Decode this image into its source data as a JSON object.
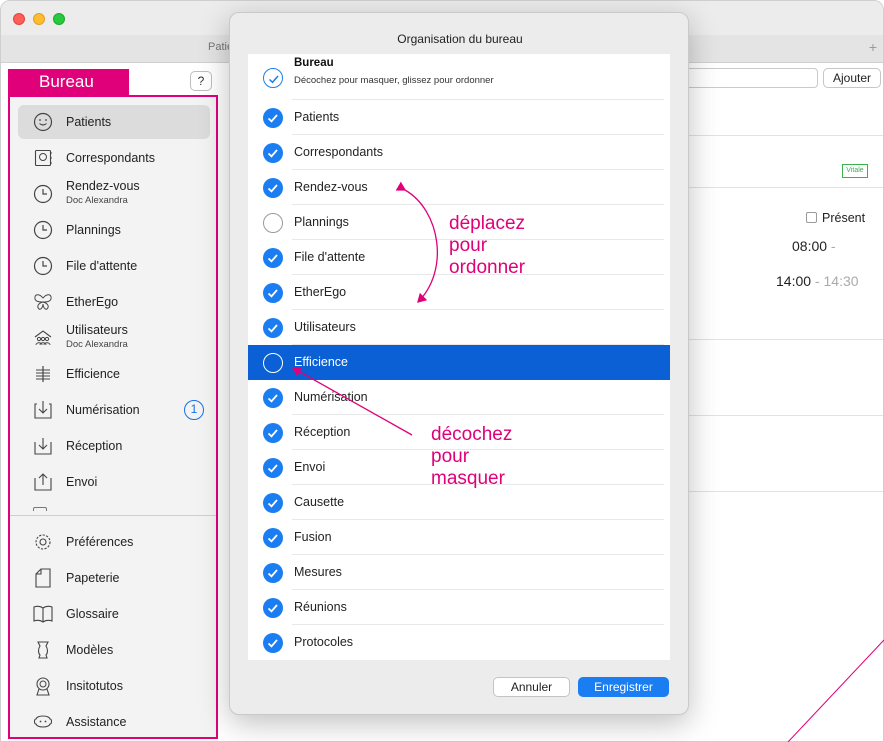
{
  "window": {
    "tab_title": "Patie",
    "tab_plus": "+"
  },
  "sidebar": {
    "title": "Bureau",
    "help": "?",
    "items": [
      {
        "label": "Patients",
        "icon": "smiley-icon",
        "selected": true
      },
      {
        "label": "Correspondants",
        "icon": "contact-card-icon"
      },
      {
        "label": "Rendez-vous",
        "sub": "Doc Alexandra",
        "icon": "clock-icon"
      },
      {
        "label": "Plannings",
        "icon": "clock-icon"
      },
      {
        "label": "File d'attente",
        "icon": "clock-icon"
      },
      {
        "label": "EtherEgo",
        "icon": "butterfly-icon"
      },
      {
        "label": "Utilisateurs",
        "sub": "Doc Alexandra",
        "icon": "users-icon"
      },
      {
        "label": "Efficience",
        "icon": "efficience-icon"
      },
      {
        "label": "Numérisation",
        "icon": "scan-icon",
        "badge": "1"
      },
      {
        "label": "Réception",
        "icon": "inbox-icon"
      },
      {
        "label": "Envoi",
        "icon": "outbox-icon"
      }
    ],
    "bottom_items": [
      {
        "label": "Préférences",
        "icon": "gear-icon"
      },
      {
        "label": "Papeterie",
        "icon": "paper-icon"
      },
      {
        "label": "Glossaire",
        "icon": "book-icon"
      },
      {
        "label": "Modèles",
        "icon": "template-icon"
      },
      {
        "label": "Insitotutos",
        "icon": "award-icon"
      },
      {
        "label": "Assistance",
        "icon": "assistance-icon"
      }
    ]
  },
  "main": {
    "add_button": "Ajouter",
    "vitale": "Vitale",
    "present_label": "Présent",
    "time1_start": "08:00",
    "time1_sep": " -",
    "time2_start": "14:00",
    "time2_sep": " - ",
    "time2_end": "14:30"
  },
  "modal": {
    "title": "Organisation du bureau",
    "header_row": {
      "title": "Bureau",
      "description": "Décochez pour masquer, glissez pour ordonner"
    },
    "rows": [
      {
        "label": "Patients",
        "checked": true
      },
      {
        "label": "Correspondants",
        "checked": true
      },
      {
        "label": "Rendez-vous",
        "checked": true
      },
      {
        "label": "Plannings",
        "checked": false
      },
      {
        "label": "File d'attente",
        "checked": true
      },
      {
        "label": "EtherEgo",
        "checked": true
      },
      {
        "label": "Utilisateurs",
        "checked": true
      },
      {
        "label": "Efficience",
        "checked": false,
        "selected": true
      },
      {
        "label": "Numérisation",
        "checked": true
      },
      {
        "label": "Réception",
        "checked": true
      },
      {
        "label": "Envoi",
        "checked": true
      },
      {
        "label": "Causette",
        "checked": true
      },
      {
        "label": "Fusion",
        "checked": true
      },
      {
        "label": "Mesures",
        "checked": true
      },
      {
        "label": "Réunions",
        "checked": true
      },
      {
        "label": "Protocoles",
        "checked": true
      }
    ],
    "cancel": "Annuler",
    "save": "Enregistrer"
  },
  "annotations": {
    "reorder": [
      "déplacez",
      "pour",
      "ordonner"
    ],
    "uncheck": [
      "décochez",
      "pour",
      "masquer"
    ]
  },
  "colors": {
    "accent": "#e0007a",
    "check_blue": "#1a7ef2",
    "selection_blue": "#0a60d4"
  }
}
